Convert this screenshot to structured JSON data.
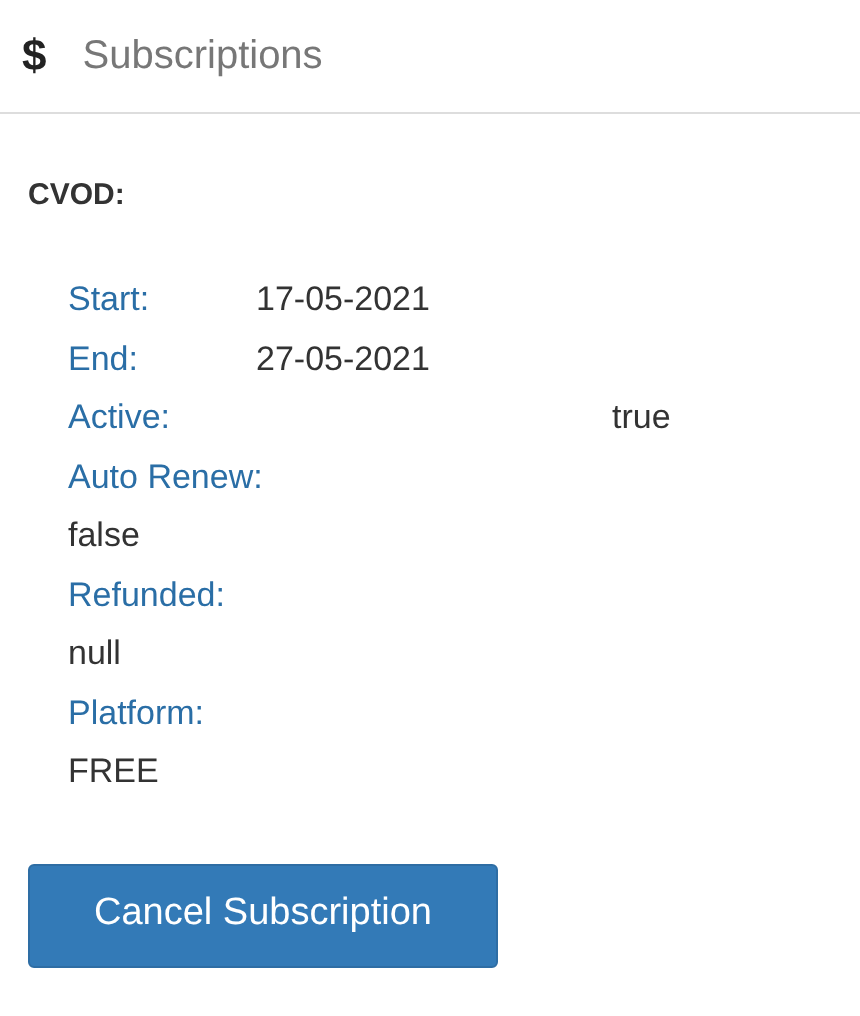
{
  "header": {
    "icon": "$",
    "title": "Subscriptions"
  },
  "section_title": "CVOD:",
  "fields": [
    {
      "kind": "inline",
      "label": "Start:",
      "value": "17-05-2021"
    },
    {
      "kind": "inline",
      "label": "End:",
      "value": "27-05-2021"
    },
    {
      "kind": "wide",
      "label": "Active:",
      "value": "true"
    },
    {
      "kind": "stacked",
      "label": "Auto Renew:",
      "value": "false"
    },
    {
      "kind": "stacked",
      "label": "Refunded:",
      "value": "null"
    },
    {
      "kind": "stacked",
      "label": "Platform:",
      "value": "FREE"
    }
  ],
  "button": "Cancel Subscription"
}
